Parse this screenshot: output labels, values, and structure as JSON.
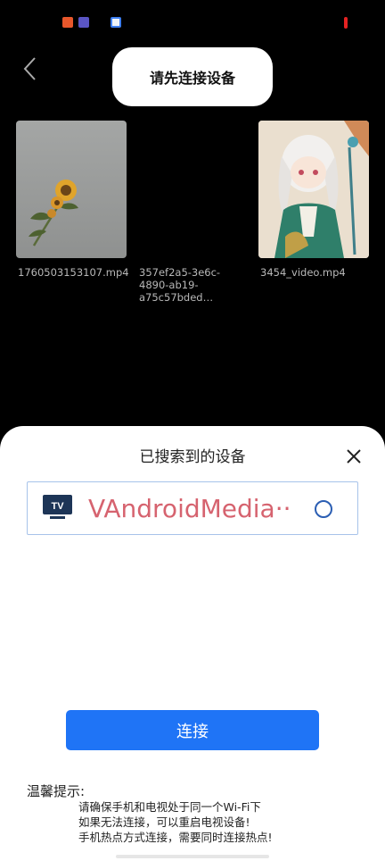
{
  "toast": {
    "text": "请先连接设备"
  },
  "videos": [
    {
      "label": "1760503153107.mp4"
    },
    {
      "label": "357ef2a5-3e6c-4890-ab19-a75c57bded…"
    },
    {
      "label": "3454_video.mp4"
    }
  ],
  "dialog": {
    "title": "已搜索到的设备",
    "device": {
      "icon_text": "TV",
      "name": "VAndroidMedia··"
    },
    "connect_label": "连接",
    "tips": {
      "title": "温馨提示:",
      "lines": [
        "请确保手机和电视处于同一个Wi-Fi下",
        "如果无法连接，可以重启电视设备!",
        "手机热点方式连接，需要同时连接热点!"
      ]
    }
  },
  "colors": {
    "accent": "#1f74f6",
    "device_name": "#d6636f",
    "radio": "#2b5eb3",
    "tv_icon": "#1d3557"
  }
}
